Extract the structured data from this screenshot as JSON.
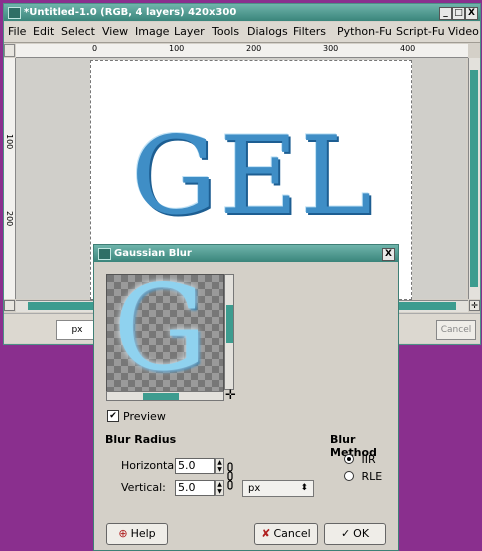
{
  "window": {
    "title": "*Untitled-1.0 (RGB, 4 layers) 420x300",
    "controls": [
      "_",
      "□",
      "X"
    ]
  },
  "menubar": {
    "items": [
      "File",
      "Edit",
      "Select",
      "View",
      "Image",
      "Layer",
      "Tools",
      "Dialogs",
      "Filters",
      "Python-Fu",
      "Script-Fu",
      "Video"
    ]
  },
  "rulers": {
    "horizontal": [
      "0",
      "100",
      "200",
      "300",
      "400"
    ],
    "vertical": [
      "100",
      "200"
    ]
  },
  "canvas": {
    "text": "GEL"
  },
  "statusbar": {
    "unit": "px",
    "cancel_label": "Cancel"
  },
  "dialog": {
    "title": "Gaussian Blur",
    "close_label": "X",
    "preview_letter": "G",
    "preview_label": "Preview",
    "preview_checked": true,
    "blur_radius_heading": "Blur Radius",
    "horizontal_label": "Horizontal:",
    "horizontal_value": "5.0",
    "vertical_label": "Vertical:",
    "vertical_value": "5.0",
    "unit_value": "px",
    "blur_method_heading": "Blur Method",
    "methods": [
      {
        "label": "IIR",
        "selected": true
      },
      {
        "label": "RLE",
        "selected": false
      }
    ],
    "help_label": "Help",
    "cancel_label": "Cancel",
    "ok_label": "OK"
  },
  "colors": {
    "desktop": "#8a2f8e",
    "titlebar": "#3a857b",
    "scroll_thumb": "#3d9c8f",
    "logo_text": "#3f8ec6"
  }
}
